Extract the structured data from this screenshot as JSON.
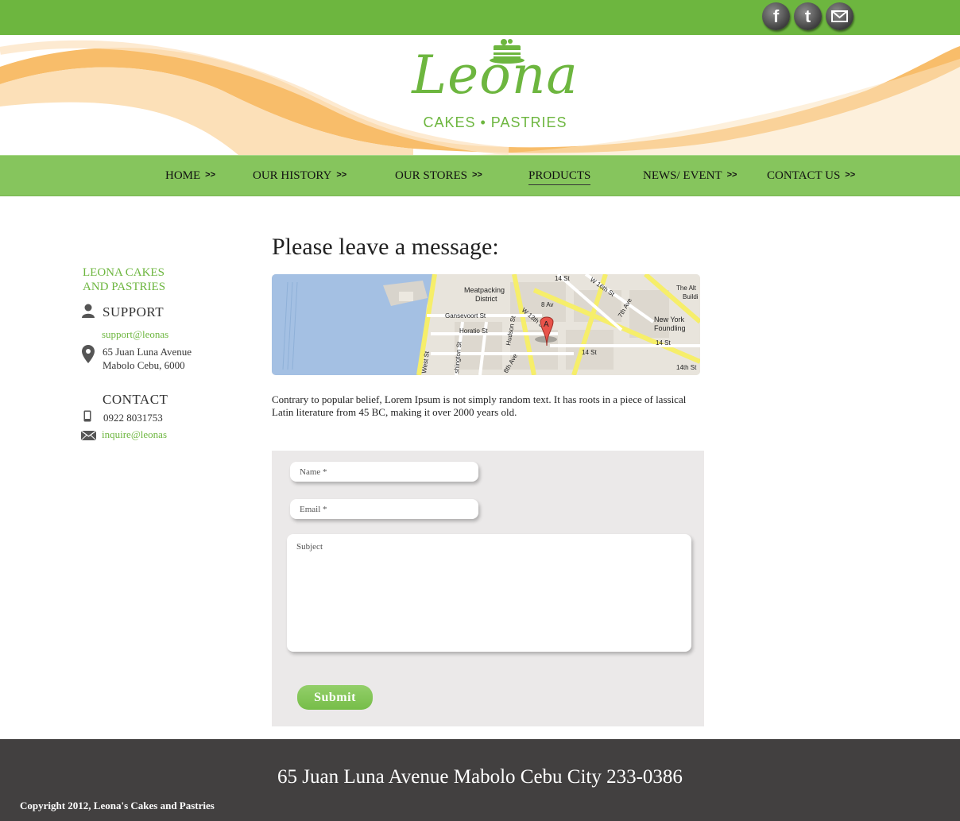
{
  "social": {
    "facebook": "f",
    "twitter": "t",
    "mail_icon": "mail-icon"
  },
  "brand": {
    "name": "Leona",
    "tagline": "CAKES • PASTRIES"
  },
  "nav": {
    "arrow": ">>",
    "items": [
      {
        "label": "HOME"
      },
      {
        "label": "OUR HISTORY"
      },
      {
        "label": "OUR STORES"
      },
      {
        "label": "PRODUCTS"
      },
      {
        "label": "NEWS/ EVENT"
      },
      {
        "label": "CONTACT US"
      }
    ],
    "active": "PRODUCTS"
  },
  "sidebar": {
    "title_line1": "LEONA CAKES",
    "title_line2": "AND PASTRIES",
    "support_heading": "SUPPORT",
    "support_email": "support@leonas",
    "address_line1": "65 Juan Luna Avenue",
    "address_line2": "Mabolo Cebu, 6000",
    "contact_heading": "CONTACT",
    "phone": "0922 8031753",
    "inquire_email": "inquire@leonas"
  },
  "main": {
    "title": "Please leave a message:",
    "paragraph": "Contrary to popular belief, Lorem Ipsum is not simply random text. It has roots in a piece of lassical Latin literature from 45 BC, making it over 2000 years old."
  },
  "map": {
    "labels": {
      "meatpacking1": "Meatpacking",
      "meatpacking2": "District",
      "gansevoort": "Gansevoort St",
      "horatio": "Horatio St",
      "hudson": "Hudson St",
      "w13": "W 13th St",
      "av8": "8 Av",
      "st14a": "14 St",
      "st14b": "14 St",
      "st14c": "14 St",
      "w16": "W 16th St",
      "av7": "7th Ave",
      "ny1": "New York",
      "ny2": "Foundling",
      "alt1": "The Alt",
      "alt2": "Buildi",
      "st14th": "14th St",
      "west": "West St",
      "washington": "shington St",
      "av8b": "8th Ave",
      "marker": "A"
    }
  },
  "form": {
    "name_placeholder": "Name *",
    "email_placeholder": "Email *",
    "subject_placeholder": "Subject",
    "submit_label": "Submit"
  },
  "footer": {
    "address": "65 Juan Luna Avenue Mabolo Cebu City 233-0386",
    "copyright": "Copyright 2012, Leona's Cakes and Pastries"
  }
}
